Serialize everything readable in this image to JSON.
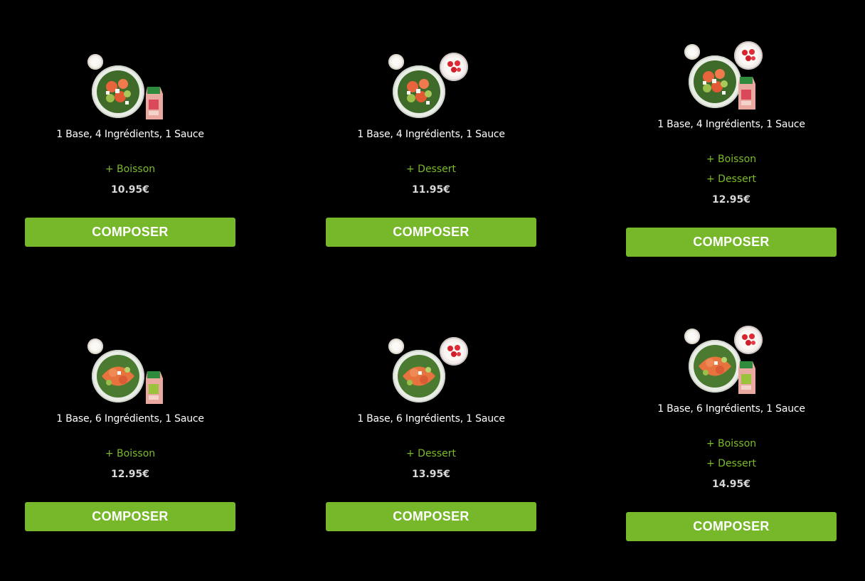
{
  "colors": {
    "accent": "#76b82a",
    "extra_text": "#7cbb28",
    "background": "#000000"
  },
  "menus": [
    {
      "description": "1 Base, 4 Ingrédients, 1 Sauce",
      "extras": [
        "+ Boisson"
      ],
      "price": "10.95€",
      "button_label": "COMPOSER"
    },
    {
      "description": "1 Base, 4 Ingrédients, 1 Sauce",
      "extras": [
        "+ Dessert"
      ],
      "price": "11.95€",
      "button_label": "COMPOSER"
    },
    {
      "description": "1 Base, 4 Ingrédients, 1 Sauce",
      "extras": [
        "+ Boisson",
        "+ Dessert"
      ],
      "price": "12.95€",
      "button_label": "COMPOSER"
    },
    {
      "description": "1 Base, 6 Ingrédients, 1 Sauce",
      "extras": [
        "+ Boisson"
      ],
      "price": "12.95€",
      "button_label": "COMPOSER"
    },
    {
      "description": "1 Base, 6 Ingrédients, 1 Sauce",
      "extras": [
        "+ Dessert"
      ],
      "price": "13.95€",
      "button_label": "COMPOSER"
    },
    {
      "description": "1 Base, 6 Ingrédients, 1 Sauce",
      "extras": [
        "+ Boisson",
        "+ Dessert"
      ],
      "price": "14.95€",
      "button_label": "COMPOSER"
    }
  ]
}
